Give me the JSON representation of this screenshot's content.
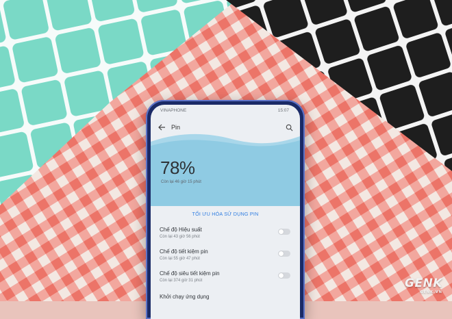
{
  "colors": {
    "teal": "#79d8c4",
    "black_board": "#202020",
    "gingham_red": "#ef7f73",
    "gingham_white": "#f3e8e2",
    "phone_frame": "#1a2a66",
    "accent_blue": "#2f7de1"
  },
  "status": {
    "carrier": "VINAPHONE",
    "time": "15:07"
  },
  "appbar": {
    "title": "Pin",
    "back_icon": "arrow-left-icon",
    "search_icon": "search-icon"
  },
  "battery": {
    "percent": "78%",
    "remaining": "Còn lại 46 giờ 15 phút",
    "level": 0.78
  },
  "optimize_label": "TỐI ƯU HÓA SỬ DỤNG PIN",
  "modes": [
    {
      "name": "Chế độ Hiệu suất",
      "sub": "Còn lại 43 giờ 56 phút",
      "enabled": false
    },
    {
      "name": "Chế độ tiết kiệm pin",
      "sub": "Còn lại 55 giờ 47 phút",
      "enabled": false
    },
    {
      "name": "Chế độ siêu tiết kiệm pin",
      "sub": "Còn lại 374 giờ 31 phút",
      "enabled": false
    },
    {
      "name": "Khởi chạy ứng dụng",
      "sub": "",
      "enabled": false
    }
  ],
  "watermark": {
    "brand": "GENK",
    "small": "GENK.VN"
  }
}
